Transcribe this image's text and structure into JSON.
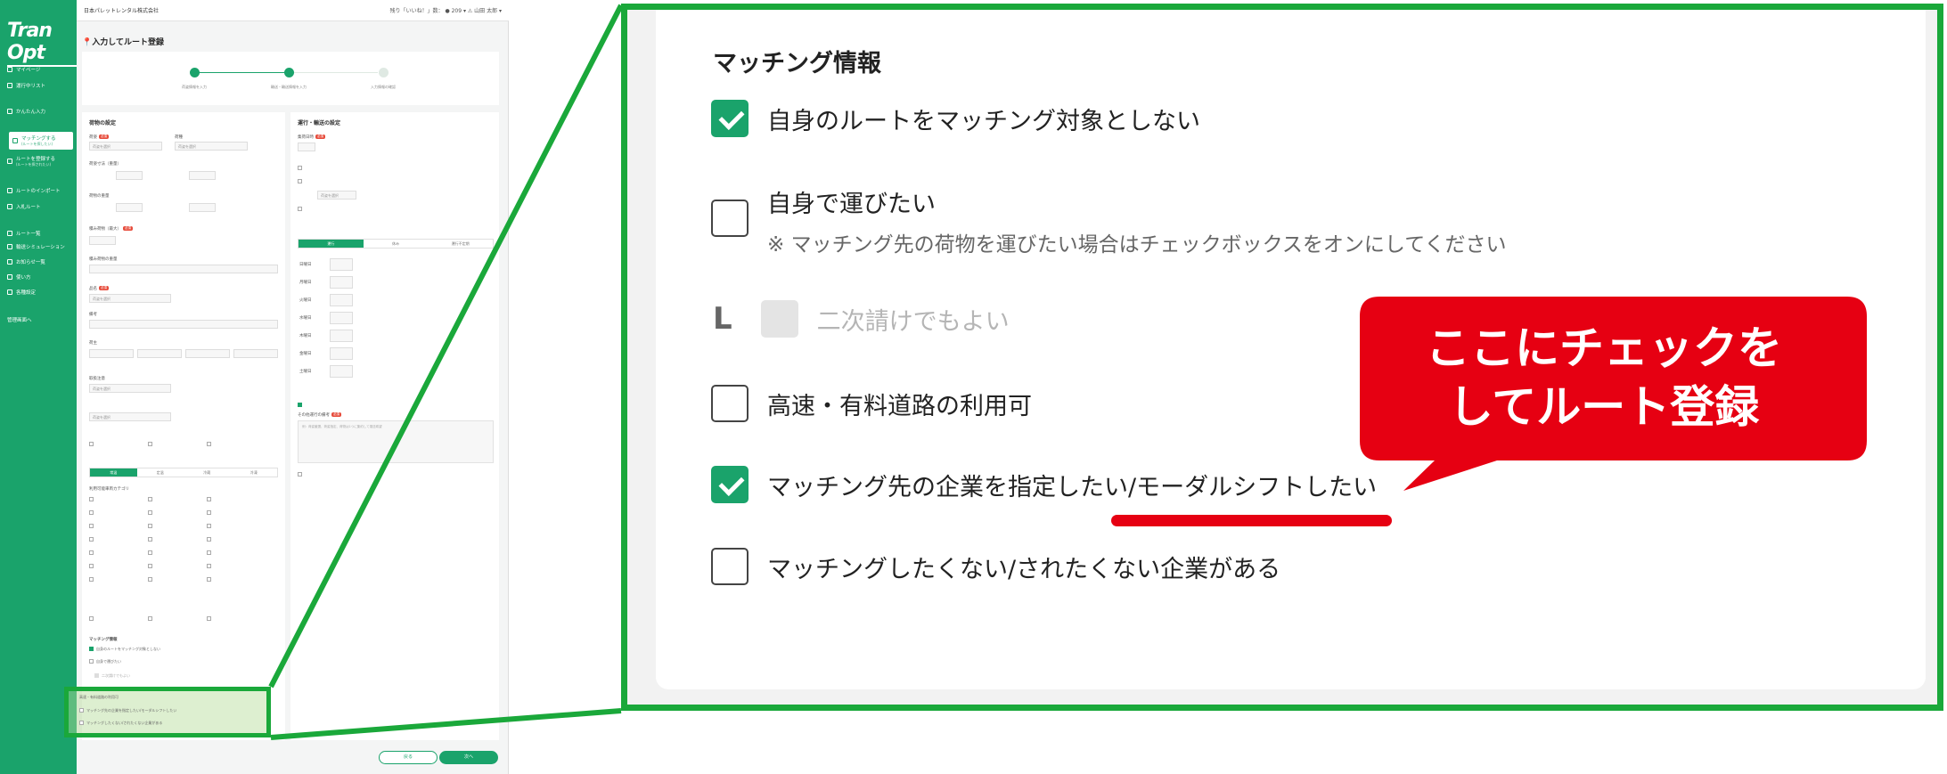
{
  "app": {
    "logo_text": "Tran Opt",
    "company": "日本パレットレンタル株式会社",
    "topbar_right": "残り「いいね！」数：  ● 209 ▾   ⚠   山田 太郎 ▾",
    "page_title": "入力してルート登録",
    "nav": [
      {
        "label": "マイページ"
      },
      {
        "label": "運行中リスト"
      },
      {
        "label": "かんたん入力"
      },
      {
        "label": "マッチングする",
        "sub": "(ルートを探したい)"
      },
      {
        "label": "ルートを登録する",
        "sub": "(ルートを探されたい)"
      },
      {
        "label": "ルートのインポート"
      },
      {
        "label": "入札ルート"
      },
      {
        "label": "ルート一覧"
      },
      {
        "label": "輸送シミュレーション"
      },
      {
        "label": "お知らせ一覧"
      },
      {
        "label": "使い方"
      },
      {
        "label": "各種設定"
      },
      {
        "label": "管理画面へ"
      }
    ],
    "steps": [
      "荷姿情報を入力",
      "輸送・輸送情報を入力",
      "入力情報の確認"
    ],
    "left_card": {
      "heading": "荷物の設定",
      "fields": [
        "荷姿",
        "荷種",
        "荷姿寸法（重量）",
        "荷物の重量",
        "積み荷物（最大）",
        "積み荷物の重量",
        "品名",
        "備考",
        "荷主",
        "取扱注意"
      ],
      "select_placeholder": "荷姿を選択",
      "tabs": [
        "常温",
        "定温",
        "冷蔵",
        "冷凍"
      ],
      "checkboxes_label": "利用可能車両カテゴリ",
      "matching_heading": "マッチング情報",
      "matching_items": [
        "自身のルートをマッチング対象としない",
        "自身で運びたい",
        "二次請けでもよい",
        "高速・有料道路の利用可",
        "マッチング先の企業を指定したい/モーダルシフトしたい",
        "マッチングしたくない/されたくない企業がある"
      ]
    },
    "right_card": {
      "heading": "運行・輸送の設定",
      "days_label": "集荷日時",
      "tabs": [
        "運行",
        "休み",
        "運行不定期"
      ],
      "weekdays": [
        "日曜日",
        "月曜日",
        "火曜日",
        "水曜日",
        "木曜日",
        "金曜日",
        "土曜日"
      ],
      "memo_label": "その他運行の備考",
      "memo_placeholder": "例：荷姿厳選、荷姿指定、荷物は1つに集約して運送希望"
    },
    "back_label": "戻る",
    "next_label": "次へ"
  },
  "zoom": {
    "title": "マッチング情報",
    "items": [
      {
        "label": "自身のルートをマッチング対象としない",
        "checked": true
      },
      {
        "label": "自身で運びたい",
        "checked": false,
        "note": "※ マッチング先の荷物を運びたい場合はチェックボックスをオンにしてください"
      },
      {
        "label": "二次請けでもよい",
        "checked": false,
        "disabled": true,
        "prefix": "L"
      },
      {
        "label": "高速・有料道路の利用可",
        "checked": false
      },
      {
        "label": "マッチング先の企業を指定したい/モーダルシフトしたい",
        "checked": true
      },
      {
        "label": "マッチングしたくない/されたくない企業がある",
        "checked": false
      }
    ]
  },
  "callout": {
    "line1": "ここにチェックを",
    "line2": "してルート登録"
  },
  "colors": {
    "brand_green": "#1aa36b",
    "highlight_green": "#1aa83a",
    "callout_red": "#e60012"
  }
}
